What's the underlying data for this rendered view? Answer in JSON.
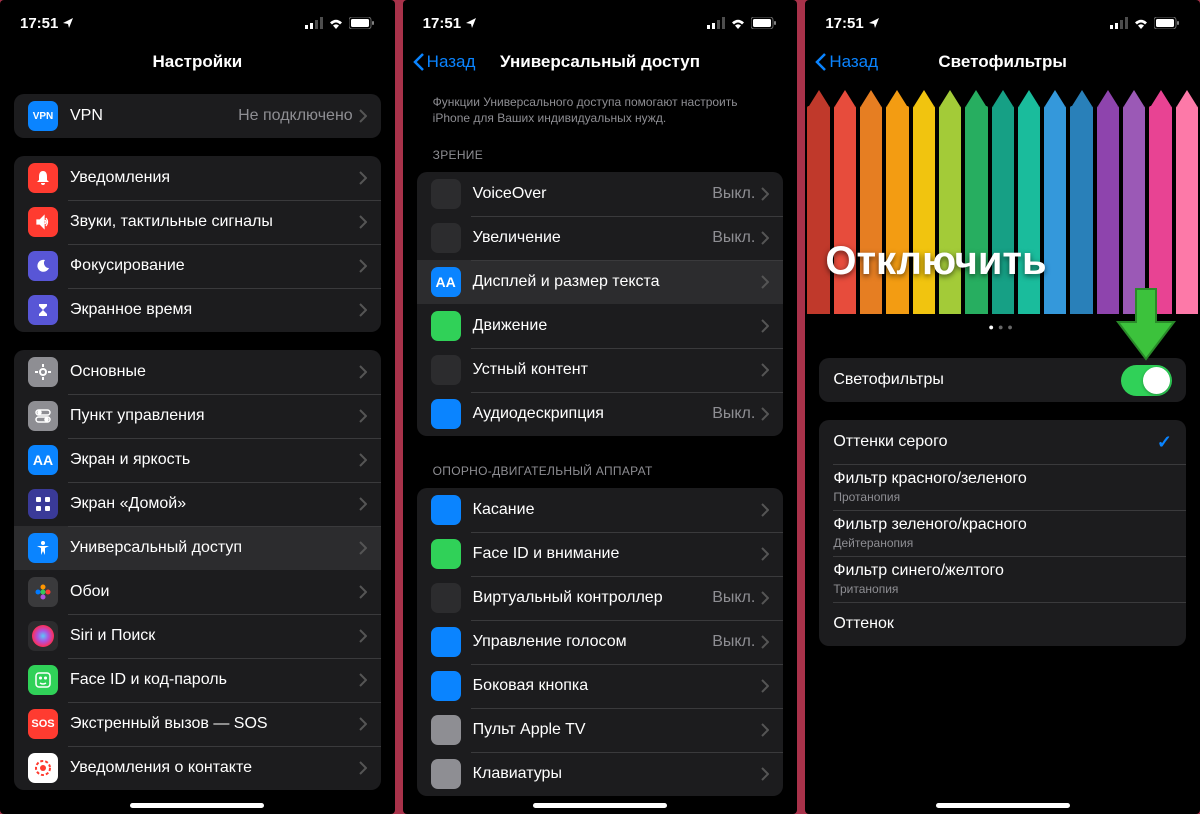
{
  "status": {
    "time": "17:51"
  },
  "screen1": {
    "title": "Настройки",
    "vpn": {
      "label": "VPN",
      "value": "Не подключено"
    },
    "group2": [
      {
        "label": "Уведомления",
        "icon_bg": "#ff3b30",
        "icon": "bell"
      },
      {
        "label": "Звуки, тактильные сигналы",
        "icon_bg": "#ff3b30",
        "icon": "sound"
      },
      {
        "label": "Фокусирование",
        "icon_bg": "#5856d6",
        "icon": "moon"
      },
      {
        "label": "Экранное время",
        "icon_bg": "#5856d6",
        "icon": "hourglass"
      }
    ],
    "group3": [
      {
        "label": "Основные",
        "icon_bg": "#8e8e93",
        "icon": "gear"
      },
      {
        "label": "Пункт управления",
        "icon_bg": "#8e8e93",
        "icon": "switches"
      },
      {
        "label": "Экран и яркость",
        "icon_bg": "#0a84ff",
        "icon": "AA"
      },
      {
        "label": "Экран «Домой»",
        "icon_bg": "#3a3a98",
        "icon": "grid"
      },
      {
        "label": "Универсальный доступ",
        "icon_bg": "#0a84ff",
        "icon": "accessibility",
        "selected": true
      },
      {
        "label": "Обои",
        "icon_bg": "#3a3a3c",
        "icon": "flower"
      },
      {
        "label": "Siri и Поиск",
        "icon_bg": "#2c2c2e",
        "icon": "siri"
      },
      {
        "label": "Face ID и код-пароль",
        "icon_bg": "#30d158",
        "icon": "face"
      },
      {
        "label": "Экстренный вызов — SOS",
        "icon_bg": "#ff3b30",
        "icon": "SOS"
      },
      {
        "label": "Уведомления о контакте",
        "icon_bg": "#fff",
        "icon": "contact"
      }
    ]
  },
  "screen2": {
    "back": "Назад",
    "title": "Универсальный доступ",
    "desc": "Функции Универсального доступа помогают настроить iPhone для Ваших индивидуальных нужд.",
    "header1": "ЗРЕНИЕ",
    "vision": [
      {
        "label": "VoiceOver",
        "value": "Выкл.",
        "icon_bg": "#2c2c2e"
      },
      {
        "label": "Увеличение",
        "value": "Выкл.",
        "icon_bg": "#2c2c2e"
      },
      {
        "label": "Дисплей и размер текста",
        "icon_bg": "#0a84ff",
        "icon_text": "AA",
        "selected": true
      },
      {
        "label": "Движение",
        "icon_bg": "#30d158"
      },
      {
        "label": "Устный контент",
        "icon_bg": "#2c2c2e"
      },
      {
        "label": "Аудиодескрипция",
        "value": "Выкл.",
        "icon_bg": "#0a84ff"
      }
    ],
    "header2": "ОПОРНО-ДВИГАТЕЛЬНЫЙ АППАРАТ",
    "motor": [
      {
        "label": "Касание",
        "icon_bg": "#0a84ff"
      },
      {
        "label": "Face ID и внимание",
        "icon_bg": "#30d158"
      },
      {
        "label": "Виртуальный контроллер",
        "value": "Выкл.",
        "icon_bg": "#2c2c2e"
      },
      {
        "label": "Управление голосом",
        "value": "Выкл.",
        "icon_bg": "#0a84ff"
      },
      {
        "label": "Боковая кнопка",
        "icon_bg": "#0a84ff"
      },
      {
        "label": "Пульт Apple TV",
        "icon_bg": "#8e8e93"
      },
      {
        "label": "Клавиатуры",
        "icon_bg": "#8e8e93"
      }
    ]
  },
  "screen3": {
    "back": "Назад",
    "title": "Светофильтры",
    "overlay": "Отключить",
    "toggle_label": "Светофильтры",
    "filters": [
      {
        "label": "Оттенки серого",
        "checked": true
      },
      {
        "label": "Фильтр красного/зеленого",
        "sub": "Протанопия"
      },
      {
        "label": "Фильтр зеленого/красного",
        "sub": "Дейтеранопия"
      },
      {
        "label": "Фильтр синего/желтого",
        "sub": "Тританопия"
      },
      {
        "label": "Оттенок"
      }
    ],
    "pencil_colors": [
      "#c0392b",
      "#e74c3c",
      "#e67e22",
      "#f39c12",
      "#f1c40f",
      "#a3cb38",
      "#27ae60",
      "#16a085",
      "#1abc9c",
      "#3498db",
      "#2980b9",
      "#8e44ad",
      "#9b59b6",
      "#e84393",
      "#fd79a8"
    ]
  }
}
